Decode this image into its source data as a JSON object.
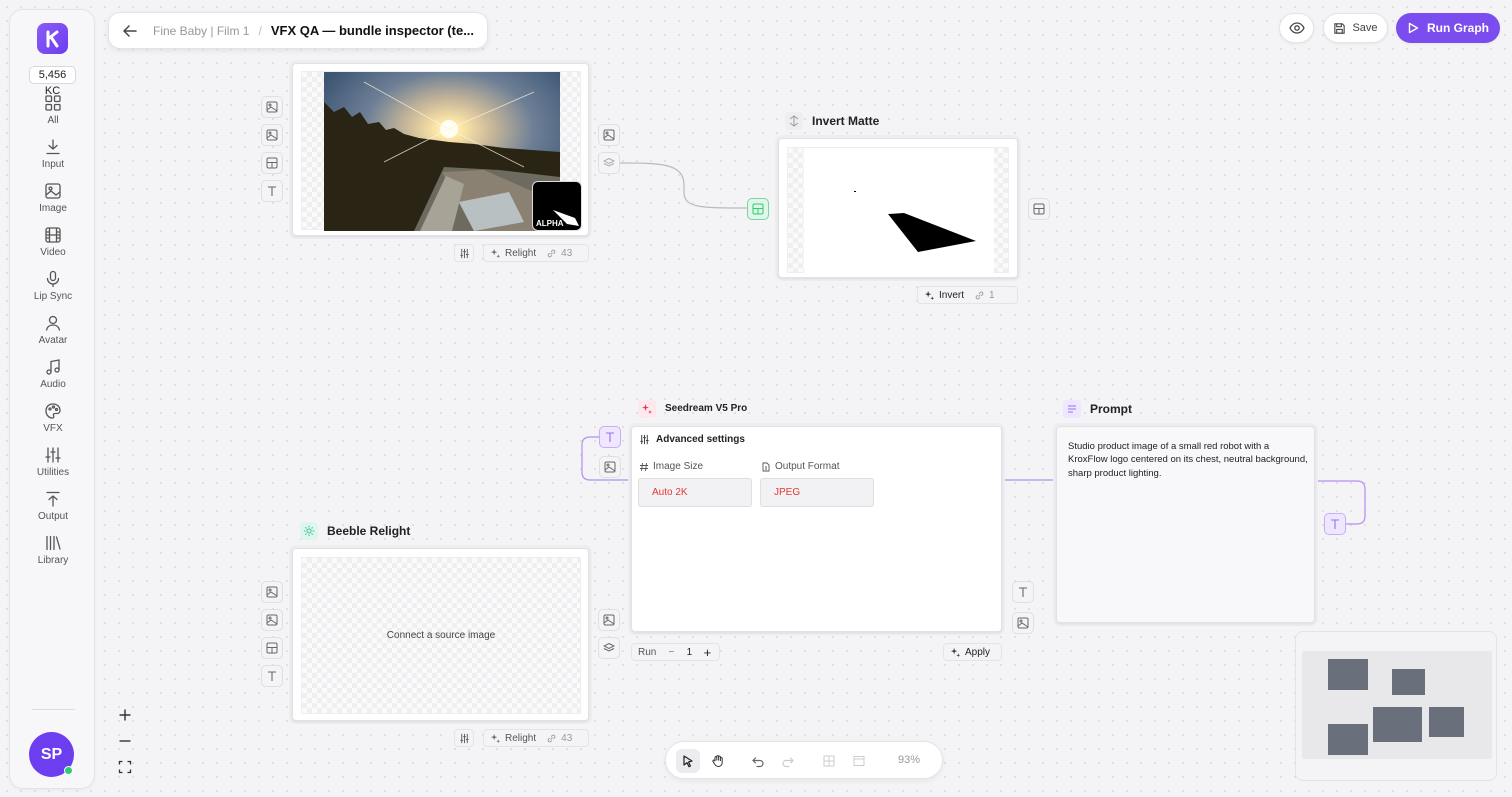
{
  "sidebar": {
    "logo": "K",
    "credits": "5,456 KC",
    "items": [
      {
        "label": "All",
        "icon": "grid-icon"
      },
      {
        "label": "Input",
        "icon": "download-icon"
      },
      {
        "label": "Image",
        "icon": "image-icon"
      },
      {
        "label": "Video",
        "icon": "film-icon"
      },
      {
        "label": "Lip Sync",
        "icon": "mic-icon"
      },
      {
        "label": "Avatar",
        "icon": "user-icon"
      },
      {
        "label": "Audio",
        "icon": "music-icon"
      },
      {
        "label": "VFX",
        "icon": "palette-icon"
      },
      {
        "label": "Utilities",
        "icon": "sliders-icon"
      },
      {
        "label": "Output",
        "icon": "upload-icon"
      },
      {
        "label": "Library",
        "icon": "library-icon"
      }
    ],
    "avatar_initials": "SP"
  },
  "header": {
    "project": "Fine Baby | Film 1",
    "separator": "/",
    "title": "VFX QA — bundle inspector (te...",
    "save_label": "Save",
    "run_label": "Run Graph"
  },
  "nodes": {
    "top_relight": {
      "alpha_label": "ALPHA",
      "chip_label": "Relight",
      "chip_count": "43"
    },
    "invert_matte": {
      "title": "Invert Matte",
      "chip_label": "Invert",
      "chip_count": "1"
    },
    "seedream": {
      "title": "Seedream V5 Pro",
      "advanced_label": "Advanced settings",
      "image_size_label": "Image Size",
      "image_size_value": "Auto 2K",
      "output_format_label": "Output Format",
      "output_format_value": "JPEG",
      "run_label": "Run",
      "run_count": "1",
      "apply_label": "Apply"
    },
    "prompt": {
      "title": "Prompt",
      "text": "Studio product image of a small red robot with a KroxFlow logo centered on its chest, neutral background, sharp product lighting."
    },
    "beeble_relight": {
      "title": "Beeble Relight",
      "placeholder": "Connect a source image",
      "chip_label": "Relight",
      "chip_count": "43"
    }
  },
  "toolbar": {
    "zoom": "93%"
  },
  "colors": {
    "accent": "#7c4dee",
    "edge_purple": "#b58ef0",
    "edge_gray": "#b9b9c0",
    "port_green": "#2ecc71",
    "field_value_red": "#e53935"
  }
}
